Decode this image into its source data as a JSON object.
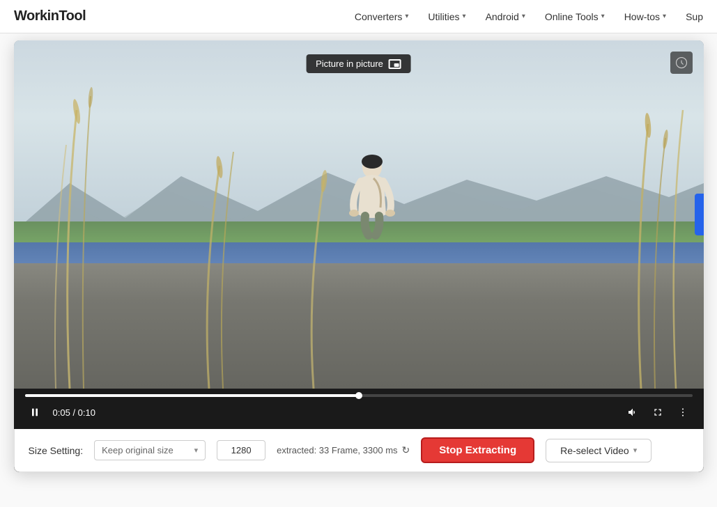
{
  "nav": {
    "logo": "WorkinTool",
    "items": [
      {
        "label": "Converters",
        "hasDropdown": true
      },
      {
        "label": "Utilities",
        "hasDropdown": true
      },
      {
        "label": "Android",
        "hasDropdown": true
      },
      {
        "label": "Online Tools",
        "hasDropdown": true
      },
      {
        "label": "How-tos",
        "hasDropdown": true
      },
      {
        "label": "Sup",
        "hasDropdown": false
      }
    ]
  },
  "video": {
    "pip_label": "Picture in picture",
    "time_current": "0:05",
    "time_total": "0:10",
    "progress_percent": 50
  },
  "bottomBar": {
    "size_label": "Size Setting:",
    "size_option": "Keep original size",
    "size_number": "1280",
    "extracted_info": "extracted: 33 Frame, 3300 ms",
    "stop_button": "Stop Extracting",
    "reselect_button": "Re-select Video"
  }
}
